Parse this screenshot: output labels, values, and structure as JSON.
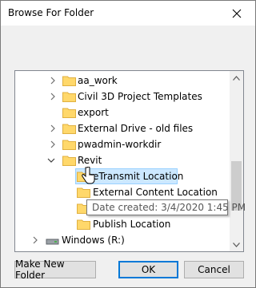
{
  "dialog": {
    "title": "Browse For Folder",
    "close_glyph": "✕"
  },
  "tree": {
    "items": [
      {
        "label": "aa_work",
        "expander": "collapsed",
        "icon": "folder-icon"
      },
      {
        "label": "Civil 3D Project Templates",
        "expander": "collapsed",
        "icon": "folder-icon"
      },
      {
        "label": "export",
        "expander": "none",
        "icon": "folder-icon"
      },
      {
        "label": "External Drive - old files",
        "expander": "collapsed",
        "icon": "folder-icon"
      },
      {
        "label": "pwadmin-workdir",
        "expander": "collapsed",
        "icon": "folder-icon"
      },
      {
        "label": "Revit",
        "expander": "expanded",
        "icon": "folder-icon"
      },
      {
        "label": "eTransmit Location",
        "expander": "none",
        "icon": "folder-icon",
        "selected": true
      },
      {
        "label": "External Content Location",
        "expander": "none",
        "icon": "folder-icon"
      },
      {
        "label": "",
        "expander": "none",
        "icon": "folder-icon"
      },
      {
        "label": "Publish Location",
        "expander": "none",
        "icon": "folder-icon"
      },
      {
        "label": "Windows (R:)",
        "expander": "collapsed",
        "icon": "drive-icon"
      }
    ],
    "tooltip": "Date created: 3/4/2020 1:45 PM"
  },
  "buttons": {
    "new_folder": "Make New Folder",
    "ok": "OK",
    "cancel": "Cancel"
  },
  "colors": {
    "selection_fill": "#cce8ff",
    "selection_border": "#99d1ff",
    "folder_yellow": "#ffd86b",
    "default_button_border": "#0078d7"
  }
}
